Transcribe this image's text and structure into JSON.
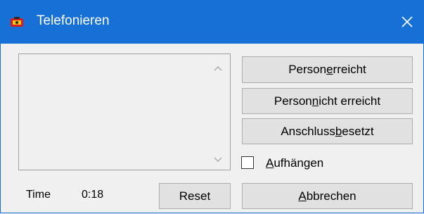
{
  "window": {
    "title": "Telefonieren",
    "accent_color": "#1670d6",
    "icon": "phone-app-icon",
    "close_icon": "close-icon"
  },
  "buttons": {
    "person_reached": {
      "pre": "Person ",
      "mnemonic": "e",
      "post": "rreicht"
    },
    "person_not_reached": {
      "pre": "Person ",
      "mnemonic": "n",
      "post": "icht erreicht"
    },
    "line_busy": {
      "pre": "Anschluss ",
      "mnemonic": "b",
      "post": "esetzt"
    },
    "abort": {
      "pre": "",
      "mnemonic": "A",
      "post": "bbrechen"
    },
    "reset": "Reset"
  },
  "checkbox": {
    "hang_up": {
      "pre": "",
      "mnemonic": "A",
      "post": "ufhängen",
      "checked": false
    }
  },
  "status": {
    "time_label": "Time",
    "time_value": "0:18"
  },
  "list": {
    "items": []
  }
}
